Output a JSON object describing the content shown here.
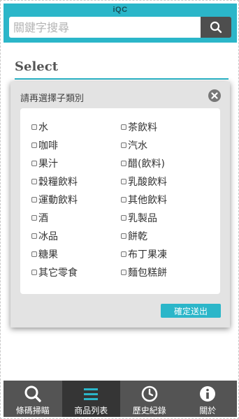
{
  "header": {
    "app_title": "iQC",
    "search": {
      "placeholder": "關鍵字搜尋",
      "value": ""
    },
    "search_button_icon": "search-icon"
  },
  "page": {
    "section_title": "Select"
  },
  "modal": {
    "title": "請再選擇子類別",
    "close_icon": "close-icon",
    "options_left": [
      "水",
      "咖啡",
      "果汁",
      "穀糧飲料",
      "運動飲料",
      "酒",
      "冰品",
      "糖果",
      "其它零食"
    ],
    "options_right": [
      "茶飲料",
      "汽水",
      "醋(飲料)",
      "乳酸飲料",
      "其他飲料",
      "乳製品",
      "餅乾",
      "布丁果凍",
      "麵包糕餅"
    ],
    "confirm_label": "確定送出"
  },
  "tabbar": {
    "tabs": [
      {
        "label": "條碼掃瞄",
        "icon": "search-icon",
        "active": false
      },
      {
        "label": "商品列表",
        "icon": "list-icon",
        "active": true
      },
      {
        "label": "歷史紀錄",
        "icon": "clock-icon",
        "active": false
      },
      {
        "label": "關於",
        "icon": "info-icon",
        "active": false
      }
    ]
  },
  "colors": {
    "accent": "#2bb6c9",
    "tabbar": "#545454",
    "tab_active": "#353535",
    "search_button": "#4e4e4e"
  }
}
